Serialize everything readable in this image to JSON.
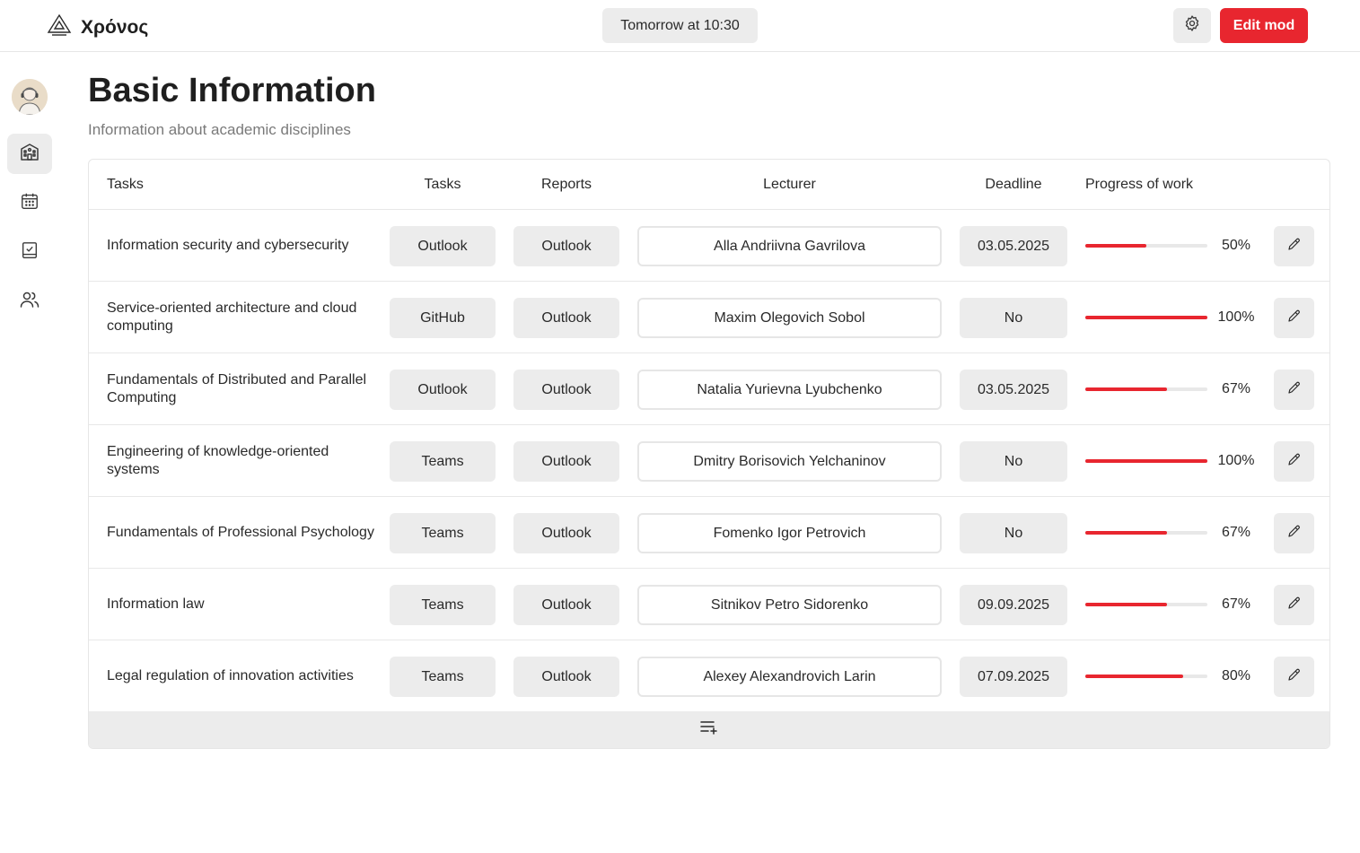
{
  "app": {
    "name": "Χρόνος",
    "logo_icon": "mountain-logo-icon"
  },
  "header": {
    "next_event": "Tomorrow at 10:30",
    "settings_icon": "gear-icon",
    "edit_label": "Edit mod"
  },
  "sidebar": {
    "items": [
      {
        "name": "avatar"
      },
      {
        "icon": "building-icon",
        "active": true
      },
      {
        "icon": "calendar-icon",
        "active": false
      },
      {
        "icon": "checklist-book-icon",
        "active": false
      },
      {
        "icon": "users-icon",
        "active": false
      }
    ]
  },
  "page": {
    "title": "Basic Information",
    "subtitle": "Information about academic disciplines"
  },
  "table": {
    "headers": [
      "Tasks",
      "Tasks",
      "Reports",
      "Lecturer",
      "Deadline",
      "Progress of work"
    ],
    "rows": [
      {
        "name": "Information security and cybersecurity",
        "tasks": "Outlook",
        "reports": "Outlook",
        "lecturer": "Alla Andriivna Gavrilova",
        "deadline": "03.05.2025",
        "progress": 50,
        "progress_label": "50%"
      },
      {
        "name": "Service-oriented architecture and cloud computing",
        "tasks": "GitHub",
        "reports": "Outlook",
        "lecturer": "Maxim Olegovich Sobol",
        "deadline": "No",
        "progress": 100,
        "progress_label": "100%"
      },
      {
        "name": "Fundamentals of Distributed and Parallel Computing",
        "tasks": "Outlook",
        "reports": "Outlook",
        "lecturer": "Natalia Yurievna Lyubchenko",
        "deadline": "03.05.2025",
        "progress": 67,
        "progress_label": "67%"
      },
      {
        "name": "Engineering of knowledge-oriented systems",
        "tasks": "Teams",
        "reports": "Outlook",
        "lecturer": "Dmitry Borisovich Yelchaninov",
        "deadline": "No",
        "progress": 100,
        "progress_label": "100%"
      },
      {
        "name": "Fundamentals of Professional Psychology",
        "tasks": "Teams",
        "reports": "Outlook",
        "lecturer": "Fomenko Igor Petrovich",
        "deadline": "No",
        "progress": 67,
        "progress_label": "67%"
      },
      {
        "name": "Information law",
        "tasks": "Teams",
        "reports": "Outlook",
        "lecturer": "Sitnikov Petro Sidorenko",
        "deadline": "09.09.2025",
        "progress": 67,
        "progress_label": "67%"
      },
      {
        "name": "Legal regulation of innovation activities",
        "tasks": "Teams",
        "reports": "Outlook",
        "lecturer": "Alexey Alexandrovich Larin",
        "deadline": "07.09.2025",
        "progress": 80,
        "progress_label": "80%"
      }
    ],
    "row_edit_icon": "pencil-icon",
    "add_row_icon": "list-add-icon"
  },
  "colors": {
    "accent": "#e8262f",
    "pill_bg": "#ececec",
    "border": "#e6e6e6"
  }
}
